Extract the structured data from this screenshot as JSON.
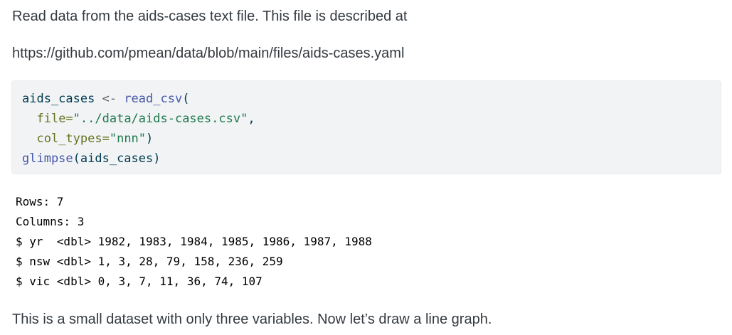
{
  "intro": {
    "line1": "Read data from the aids-cases text file. This file is described at",
    "line2": "https://github.com/pmean/data/blob/main/files/aids-cases.yaml"
  },
  "code": {
    "l1_var": "aids_cases",
    "l1_op": " <- ",
    "l1_fn": "read_csv",
    "l1_paren": "(",
    "l2_indent": "  ",
    "l2_arg": "file=",
    "l2_str": "\"../data/aids-cases.csv\"",
    "l2_comma": ",",
    "l3_indent": "  ",
    "l3_arg": "col_types=",
    "l3_str": "\"nnn\"",
    "l3_close": ")",
    "l4_fn": "glimpse",
    "l4_args": "(aids_cases)"
  },
  "output": [
    "Rows: 7",
    "Columns: 3",
    "$ yr  <dbl> 1982, 1983, 1984, 1985, 1986, 1987, 1988",
    "$ nsw <dbl> 1, 3, 28, 79, 158, 236, 259",
    "$ vic <dbl> 0, 3, 7, 11, 36, 74, 107"
  ],
  "outro": {
    "text": "This is a small dataset with only three variables. Now let’s draw a line graph."
  },
  "colors": {
    "code_background": "#f1f3f5",
    "function": "#4758ab",
    "string": "#20794d",
    "argument": "#657422"
  }
}
